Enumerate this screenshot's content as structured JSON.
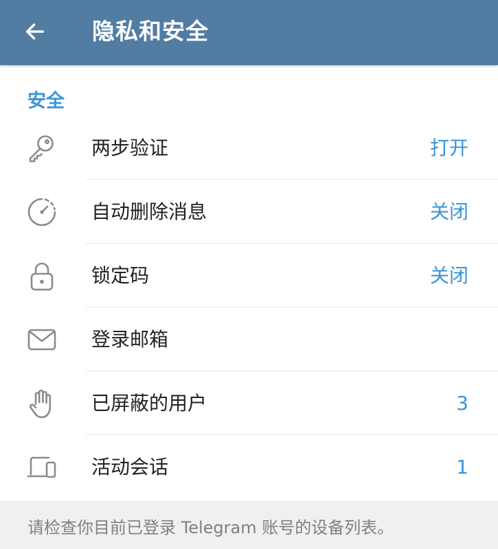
{
  "appbar": {
    "back_icon": "arrow-left-icon",
    "title": "隐私和安全",
    "background_color": "#517da2",
    "title_color": "#ffffff"
  },
  "section": {
    "header": "安全",
    "header_color": "#3a95d5"
  },
  "rows": [
    {
      "icon": "key-icon",
      "label": "两步验证",
      "value": "打开"
    },
    {
      "icon": "timer-icon",
      "label": "自动删除消息",
      "value": "关闭"
    },
    {
      "icon": "lock-icon",
      "label": "锁定码",
      "value": "关闭"
    },
    {
      "icon": "mail-icon",
      "label": "登录邮箱",
      "value": ""
    },
    {
      "icon": "hand-icon",
      "label": "已屏蔽的用户",
      "value": "3"
    },
    {
      "icon": "devices-icon",
      "label": "活动会话",
      "value": "1"
    }
  ],
  "footer": {
    "text": "请检查你目前已登录 Telegram 账号的设备列表。"
  },
  "colors": {
    "accent": "#3a95d5",
    "icon_gray": "#8a8a8a",
    "text_primary": "#222222",
    "footer_bg": "#f0f0f0"
  }
}
